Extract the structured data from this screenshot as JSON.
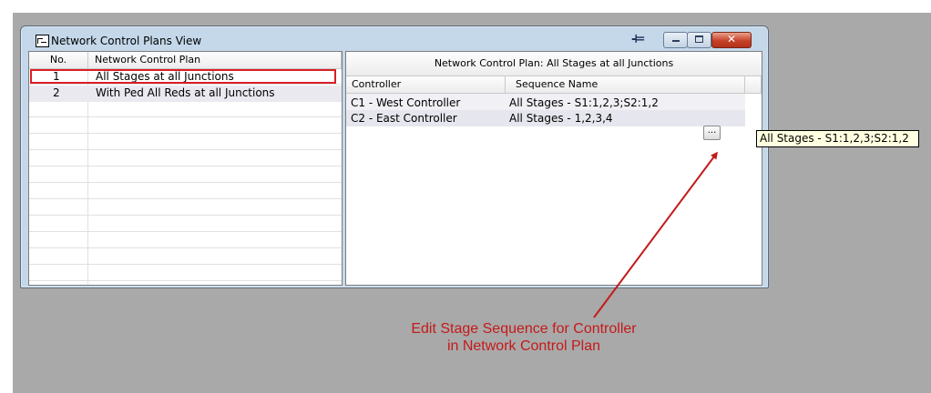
{
  "window": {
    "title": "Network Control Plans View",
    "buttons": {
      "min": "",
      "max": "",
      "close": "✕"
    }
  },
  "left_table": {
    "columns": [
      "No.",
      "Network Control Plan"
    ],
    "rows": [
      {
        "no": "1",
        "plan": "All Stages at all Junctions"
      },
      {
        "no": "2",
        "plan": "With Ped All Reds at all Junctions"
      }
    ]
  },
  "right_table": {
    "header": "Network Control Plan: All Stages at all Junctions",
    "columns": [
      "Controller",
      "Sequence Name"
    ],
    "rows": [
      {
        "controller": "C1 - West Controller",
        "sequence": "All Stages - S1:1,2,3;S2:1,2"
      },
      {
        "controller": "C2 - East Controller",
        "sequence": "All Stages - 1,2,3,4"
      }
    ],
    "ellipsis_label": "..."
  },
  "tooltip": "All Stages - S1:1,2,3;S2:1,2",
  "annotation": {
    "text": "Edit Stage Sequence for Controller in Network Control Plan",
    "color": "#c41a1a"
  }
}
